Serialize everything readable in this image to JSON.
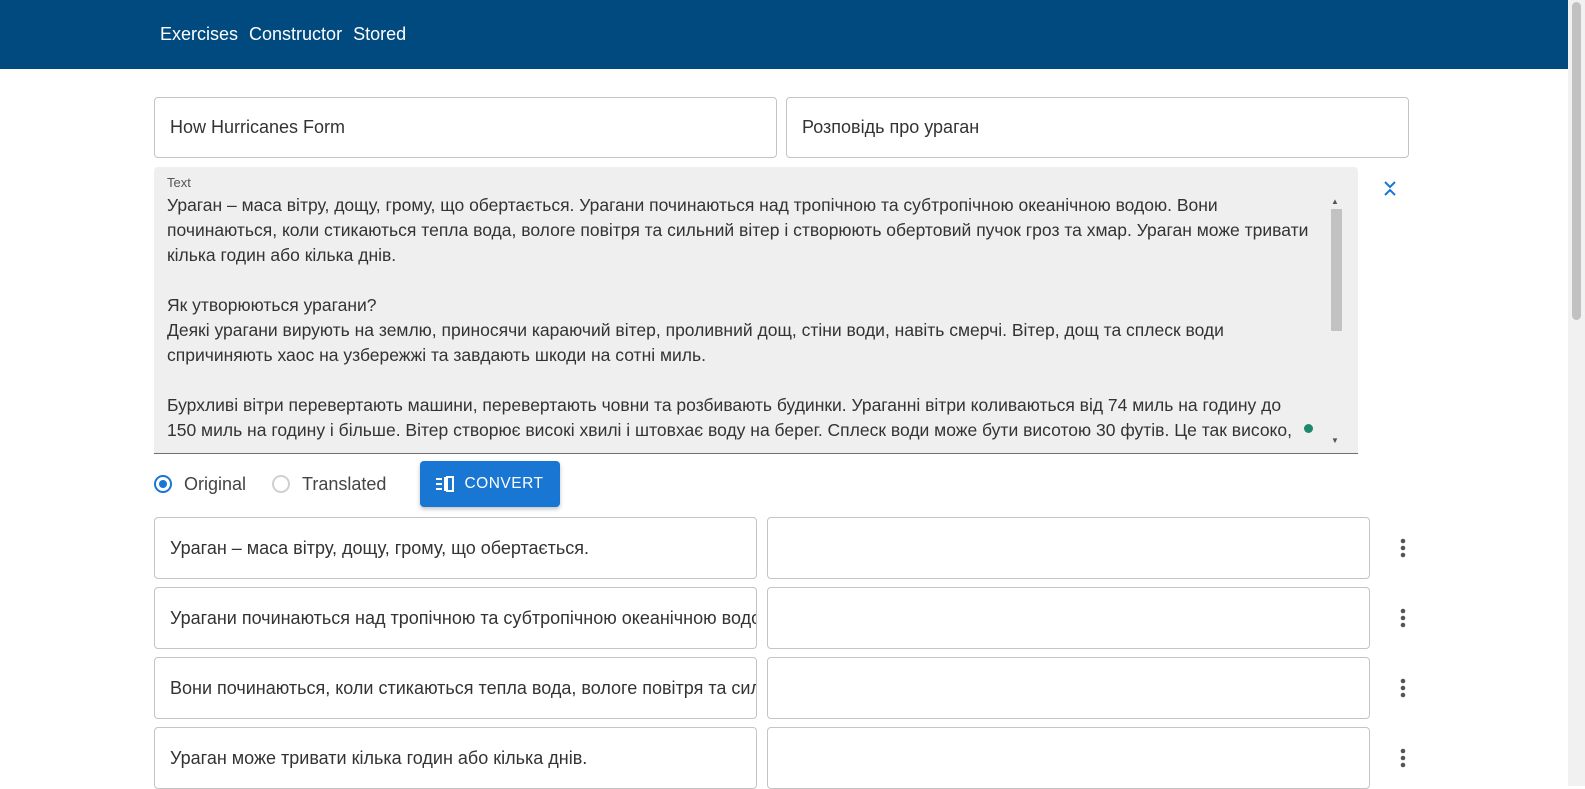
{
  "nav": {
    "items": [
      "Exercises",
      "Constructor",
      "Stored"
    ]
  },
  "titles": {
    "original": "How Hurricanes Form",
    "translated": "Розповідь про ураган"
  },
  "text_area": {
    "label": "Text",
    "content": "Ураган – маса вітру, дощу, грому, що обертається. Урагани починаються над тропічною та субтропічною океанічною водою. Вони\nпочинаються, коли стикаються тепла вода, вологе повітря та сильний вітер і створюють обертовий пучок гроз та хмар. Ураган може тривати\nкілька годин або кілька днів.\n\nЯк утворюються урагани?\nДеякі урагани вирують на землю, приносячи караючий вітер, проливний дощ, стіни води, навіть смерчі. Вітер, дощ та сплеск води\nспричиняють хаос на узбережжі та завдають шкоди на сотні миль.\n\nБурхливі вітри перевертають машини, перевертають човни та розбивають будинки. Ураганні вітри коливаються від 74 миль на годину до\n150 миль на годину і більше. Вітер створює високі хвилі і штовхає воду на берег. Сплеск води може бути висотою 30 футів. Це так високо,"
  },
  "view_mode": {
    "options": [
      "Original",
      "Translated"
    ],
    "selected": "Original"
  },
  "convert_label": "CONVERT",
  "sentences": [
    {
      "original": "Ураган – маса вітру, дощу, грому, що обертається.",
      "translated": ""
    },
    {
      "original": "Урагани починаються над тропічною та субтропічною океанічною водою.",
      "translated": ""
    },
    {
      "original": "Вони починаються, коли стикаються тепла вода, вологе повітря та сильний вітер і створюють обертовий пучок гроз та хмар.",
      "translated": ""
    },
    {
      "original": "Ураган може тривати кілька годин або кілька днів.",
      "translated": ""
    }
  ],
  "colors": {
    "topbar": "#004a7f",
    "primary": "#1976d2"
  }
}
